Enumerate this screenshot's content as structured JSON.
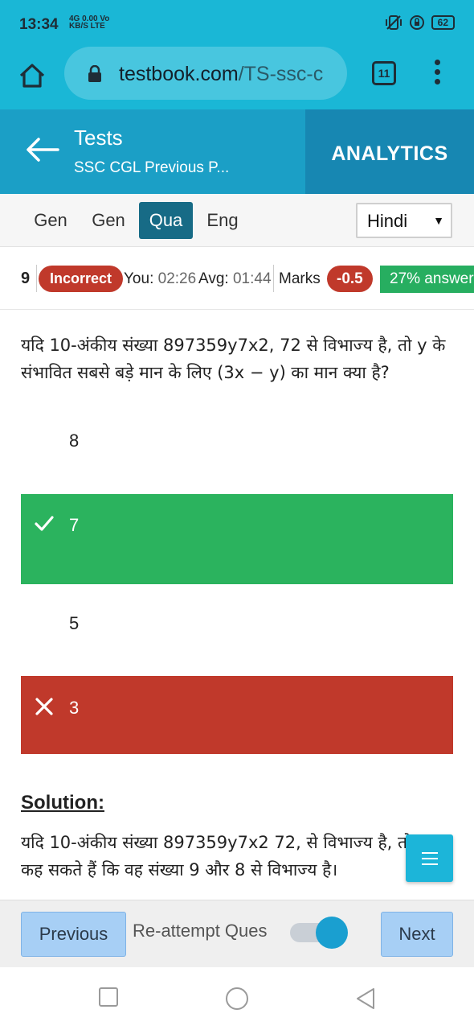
{
  "status_bar": {
    "time": "13:34",
    "network_line1": "4G 0.00 Vo",
    "network_line2": "KB/S LTE",
    "battery": "62"
  },
  "browser": {
    "url_domain": "testbook.com",
    "url_path": "/TS-ssc-c",
    "tab_count": "11"
  },
  "header": {
    "title": "Tests",
    "subtitle": "SSC CGL Previous P...",
    "analytics_label": "ANALYTICS"
  },
  "section_tabs": [
    {
      "label": "Gen",
      "active": false
    },
    {
      "label": "Gen",
      "active": false
    },
    {
      "label": "Qua",
      "active": true
    },
    {
      "label": "Eng",
      "active": false
    }
  ],
  "language": {
    "selected": "Hindi"
  },
  "stats": {
    "question_number": "9",
    "status": "Incorrect",
    "you_label": "You:",
    "you_time": "02:26",
    "avg_label": "Avg:",
    "avg_time": "01:44",
    "marks_label": "Marks",
    "marks_value": "-0.5",
    "answered": "27% answer"
  },
  "question": {
    "text": "यदि 10-अंकीय संख्या 897359y7x2, 72 से विभाज्य है, तो y के संभावित सबसे बड़े मान के लिए (3x − y) का मान क्या है?"
  },
  "options": [
    {
      "label": "8",
      "state": "none"
    },
    {
      "label": "7",
      "state": "correct"
    },
    {
      "label": "5",
      "state": "none"
    },
    {
      "label": "3",
      "state": "wrong"
    }
  ],
  "solution": {
    "heading": "Solution:",
    "text": "यदि 10-अंकीय संख्या 897359y7x2 72, से विभाज्य है, तो हम कह सकते हैं कि वह संख्या 9 और 8 से विभाज्य है।"
  },
  "footer": {
    "previous_label": "Previous",
    "reattempt_label": "Re-attempt Ques",
    "reattempt_on": true,
    "next_label": "Next"
  },
  "colors": {
    "brand": "#1ab7d6",
    "header": "#1b9fc6",
    "correct": "#2bb35e",
    "wrong": "#c0392b"
  }
}
